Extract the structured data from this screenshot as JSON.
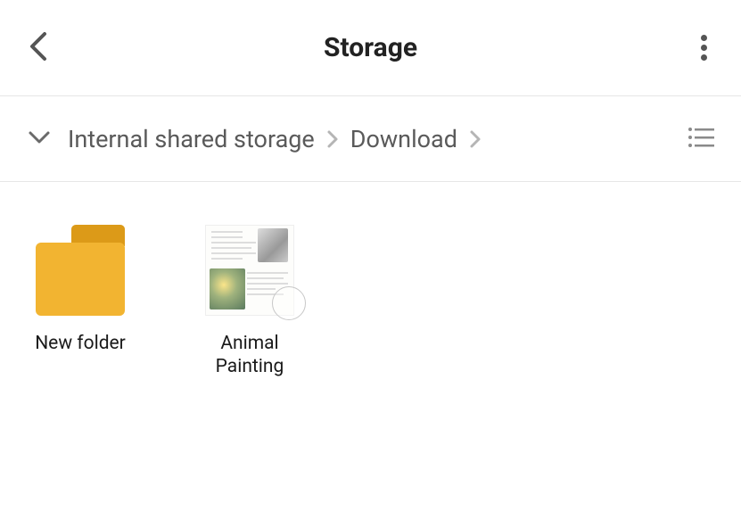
{
  "header": {
    "title": "Storage"
  },
  "breadcrumb": {
    "segments": [
      {
        "label": "Internal shared storage"
      },
      {
        "label": "Download"
      }
    ]
  },
  "items": [
    {
      "type": "folder",
      "label": "New folder"
    },
    {
      "type": "file",
      "label": "Animal Painting"
    }
  ]
}
